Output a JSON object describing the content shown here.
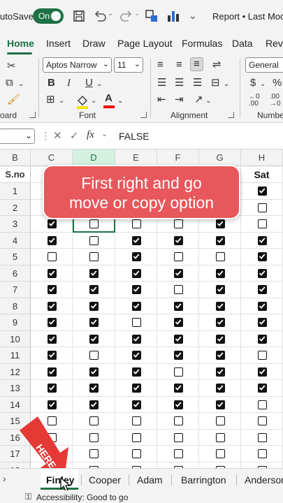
{
  "titlebar": {
    "autosave_label": "utoSave",
    "toggle_label": "On",
    "doc_title": "Report • Last Modi"
  },
  "tabs": [
    "Home",
    "Insert",
    "Draw",
    "Page Layout",
    "Formulas",
    "Data",
    "Revi"
  ],
  "ribbon": {
    "font_name": "Aptos Narrow",
    "font_size": "11",
    "number_format": "General",
    "groups": {
      "clipboard": "oard",
      "font": "Font",
      "alignment": "Alignment",
      "number": "Numbe"
    },
    "bold": "B",
    "italic": "I",
    "underline": "U",
    "currency": "$",
    "percent": "%"
  },
  "formula_bar": {
    "fx": "fx",
    "value": "FALSE"
  },
  "columns": [
    "B",
    "C",
    "D",
    "E",
    "F",
    "G",
    "H"
  ],
  "header_row": {
    "B": "S.no",
    "H": "Sat"
  },
  "rows": [
    {
      "n": "1",
      "checks": [
        null,
        null,
        null,
        null,
        null,
        true
      ]
    },
    {
      "n": "2",
      "checks": [
        null,
        null,
        null,
        null,
        null,
        false
      ]
    },
    {
      "n": "3",
      "checks": [
        true,
        false,
        false,
        false,
        true,
        false
      ]
    },
    {
      "n": "4",
      "checks": [
        true,
        false,
        true,
        true,
        true,
        true
      ]
    },
    {
      "n": "5",
      "checks": [
        false,
        false,
        true,
        false,
        false,
        true
      ]
    },
    {
      "n": "6",
      "checks": [
        true,
        true,
        true,
        true,
        true,
        true
      ]
    },
    {
      "n": "7",
      "checks": [
        true,
        true,
        true,
        false,
        true,
        true
      ]
    },
    {
      "n": "8",
      "checks": [
        true,
        true,
        true,
        true,
        true,
        true
      ]
    },
    {
      "n": "9",
      "checks": [
        true,
        true,
        false,
        true,
        true,
        true
      ]
    },
    {
      "n": "10",
      "checks": [
        true,
        true,
        true,
        true,
        true,
        true
      ]
    },
    {
      "n": "11",
      "checks": [
        true,
        false,
        true,
        true,
        true,
        false
      ]
    },
    {
      "n": "12",
      "checks": [
        true,
        true,
        true,
        false,
        true,
        true
      ]
    },
    {
      "n": "13",
      "checks": [
        true,
        true,
        true,
        true,
        true,
        true
      ]
    },
    {
      "n": "14",
      "checks": [
        true,
        true,
        true,
        true,
        true,
        false
      ]
    },
    {
      "n": "15",
      "checks": [
        false,
        false,
        false,
        false,
        false,
        false
      ]
    },
    {
      "n": "16",
      "checks": [
        false,
        false,
        false,
        false,
        false,
        false
      ]
    },
    {
      "n": "17",
      "checks": [
        false,
        false,
        false,
        false,
        false,
        false
      ]
    },
    {
      "n": "18",
      "checks": [
        false,
        false,
        false,
        false,
        false,
        false
      ]
    }
  ],
  "overlay": {
    "line1": "First right and go",
    "line2": "move or copy option",
    "here": "HERE"
  },
  "sheets": [
    "Finley",
    "Cooper",
    "Adam",
    "Barrington",
    "Anderson"
  ],
  "status": {
    "accessibility": "Accessibility: Good to go"
  },
  "colors": {
    "accent": "#1e7145",
    "banner": "#e8575b",
    "arrow": "#e53935"
  }
}
